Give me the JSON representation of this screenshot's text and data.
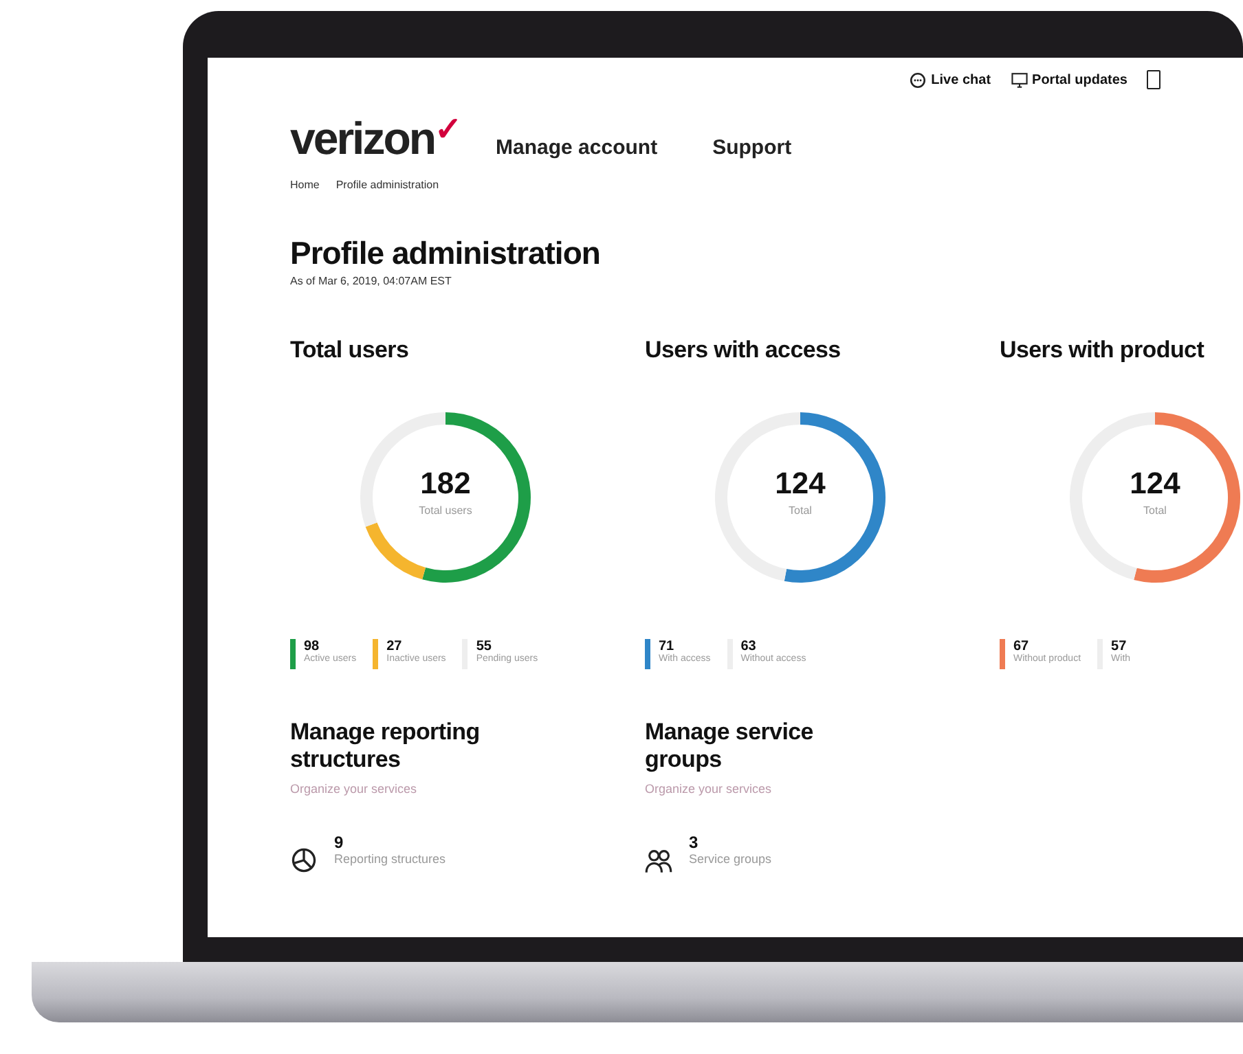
{
  "utility_links": [
    {
      "label": "Live chat"
    },
    {
      "label": "Portal updates"
    }
  ],
  "logo": {
    "text": "verizon",
    "mark": "✓"
  },
  "nav": [
    {
      "label": "Manage account"
    },
    {
      "label": "Support"
    }
  ],
  "breadcrumb": [
    "Home",
    "Profile administration"
  ],
  "page": {
    "title": "Profile administration",
    "subtitle": "As of Mar 6, 2019, 04:07AM EST"
  },
  "stats": [
    {
      "heading": "Total users",
      "total": "182",
      "total_label": "Total users",
      "legend": [
        {
          "value": "98",
          "color": "#1e9e48"
        },
        {
          "value": "27",
          "color": "#f5b52e"
        },
        {
          "value": "55",
          "color": "#eeeeee"
        }
      ],
      "chart_data": {
        "type": "donut",
        "categories": [
          "Active users",
          "Inactive users",
          "Pending users"
        ],
        "values": [
          54.4,
          15,
          30.6
        ]
      }
    },
    {
      "heading": "Users with access",
      "total": "124",
      "total_label": "Total",
      "legend": [
        {
          "value": "71",
          "color": "#2f86c8"
        },
        {
          "value": "63",
          "color": "#eeeeee"
        }
      ],
      "chart_data": {
        "type": "donut",
        "categories": [
          "With access",
          "Without access"
        ],
        "values": [
          53,
          47
        ]
      }
    },
    {
      "heading": "Users with product",
      "total": "124",
      "total_label": "Total",
      "legend": [
        {
          "value": "67",
          "color": "#ef7b53"
        },
        {
          "value": "57",
          "color": "#eeeeee"
        }
      ],
      "chart_data": {
        "type": "donut",
        "categories": [
          "Without product",
          "With"
        ],
        "values": [
          54,
          46
        ]
      }
    }
  ],
  "manage": [
    {
      "title": "Manage reporting structures",
      "subtitle": "Organize your services",
      "count": "9",
      "count_label": "Reporting structures"
    },
    {
      "title": "Manage service groups",
      "subtitle": "Organize your services",
      "count": "3",
      "count_label": "Service groups"
    }
  ]
}
